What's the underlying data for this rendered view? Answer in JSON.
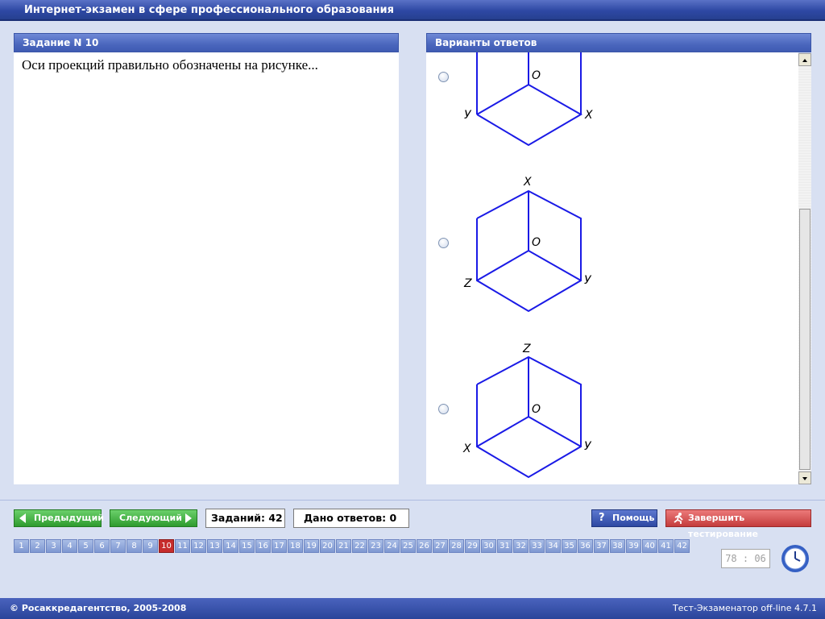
{
  "window": {
    "title": "Интернет-экзамен в сфере профессионального образования"
  },
  "task": {
    "header": "Задание N 10",
    "question": "Оси проекций правильно обозначены на рисунке..."
  },
  "answers": {
    "header": "Варианты ответов",
    "options": [
      {
        "top_label": "",
        "center": "O",
        "left": "У",
        "right": "X"
      },
      {
        "top_label": "X",
        "center": "O",
        "left": "Z",
        "right": "У"
      },
      {
        "top_label": "Z",
        "center": "O",
        "left": "X",
        "right": "У"
      }
    ]
  },
  "nav": {
    "prev_label": "Предыдущий",
    "next_label": "Следующий",
    "tasks_count": "Заданий: 42",
    "answers_given": "Дано ответов: 0",
    "help_label": "Помощь",
    "finish_label": "Завершить тестирование",
    "current_question": 10,
    "questions": [
      "1",
      "2",
      "3",
      "4",
      "5",
      "6",
      "7",
      "8",
      "9",
      "10",
      "11",
      "12",
      "13",
      "14",
      "15",
      "16",
      "17",
      "18",
      "19",
      "20",
      "21",
      "22",
      "23",
      "24",
      "25",
      "26",
      "27",
      "28",
      "29",
      "30",
      "31",
      "32",
      "33",
      "34",
      "35",
      "36",
      "37",
      "38",
      "39",
      "40",
      "41",
      "42"
    ]
  },
  "timer": {
    "value": "78 : 06"
  },
  "footer": {
    "copyright": "© Росаккредагентство, 2005-2008",
    "version": "Тест-Экзаменатор off-line 4.7.1"
  },
  "colors": {
    "figure_stroke": "#1a1ae6",
    "active_question": "#c62c2c",
    "accent": "#2e48a4"
  }
}
